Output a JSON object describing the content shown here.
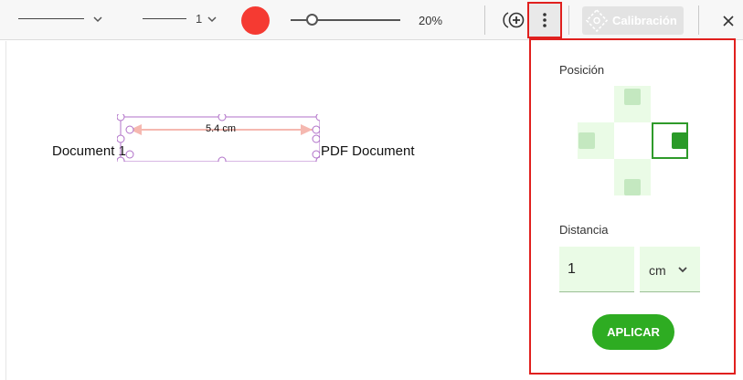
{
  "toolbar": {
    "line_width_value": "1",
    "color": "#f53a32",
    "opacity_value": "20%",
    "calibration_label": "Calibración",
    "icons": {
      "line_style": "chevron-down-icon",
      "add": "add-circle-icon",
      "more": "more-vertical-icon",
      "calibration": "calibration-icon",
      "close": "close-icon"
    }
  },
  "document": {
    "left_text": "Document 1",
    "right_text": "PDF Document",
    "measurement_label": "5.4 cm"
  },
  "panel": {
    "position_title": "Posición",
    "distance_title": "Distancia",
    "distance_value": "1",
    "unit_value": "cm",
    "apply_label": "APLICAR",
    "selected_position": "right",
    "colors": {
      "accent": "#2eac22",
      "highlight": "#e0201e"
    }
  }
}
